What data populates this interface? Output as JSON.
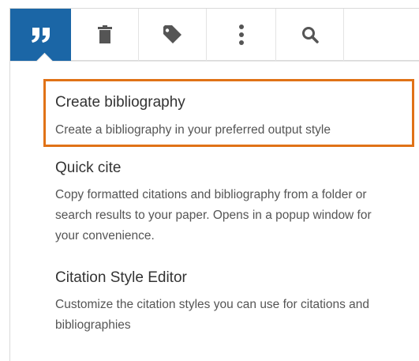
{
  "toolbar": {
    "buttons": [
      {
        "name": "cite",
        "icon": "quote-icon",
        "active": true
      },
      {
        "name": "delete",
        "icon": "trash-icon"
      },
      {
        "name": "tag",
        "icon": "tag-icon"
      },
      {
        "name": "more",
        "icon": "more-vertical-icon"
      },
      {
        "name": "search",
        "icon": "search-icon"
      }
    ],
    "active_color": "#1b66a6"
  },
  "menu": {
    "items": [
      {
        "title": "Create bibliography",
        "description": "Create a bibliography in your preferred output style"
      },
      {
        "title": "Quick cite",
        "description": "Copy formatted citations and bibliography from a folder or search results to your paper. Opens in a popup window for your convenience."
      },
      {
        "title": "Citation Style Editor",
        "description": "Customize the citation styles you can use for citations and bibliographies"
      }
    ]
  },
  "highlight_color": "#e07217"
}
